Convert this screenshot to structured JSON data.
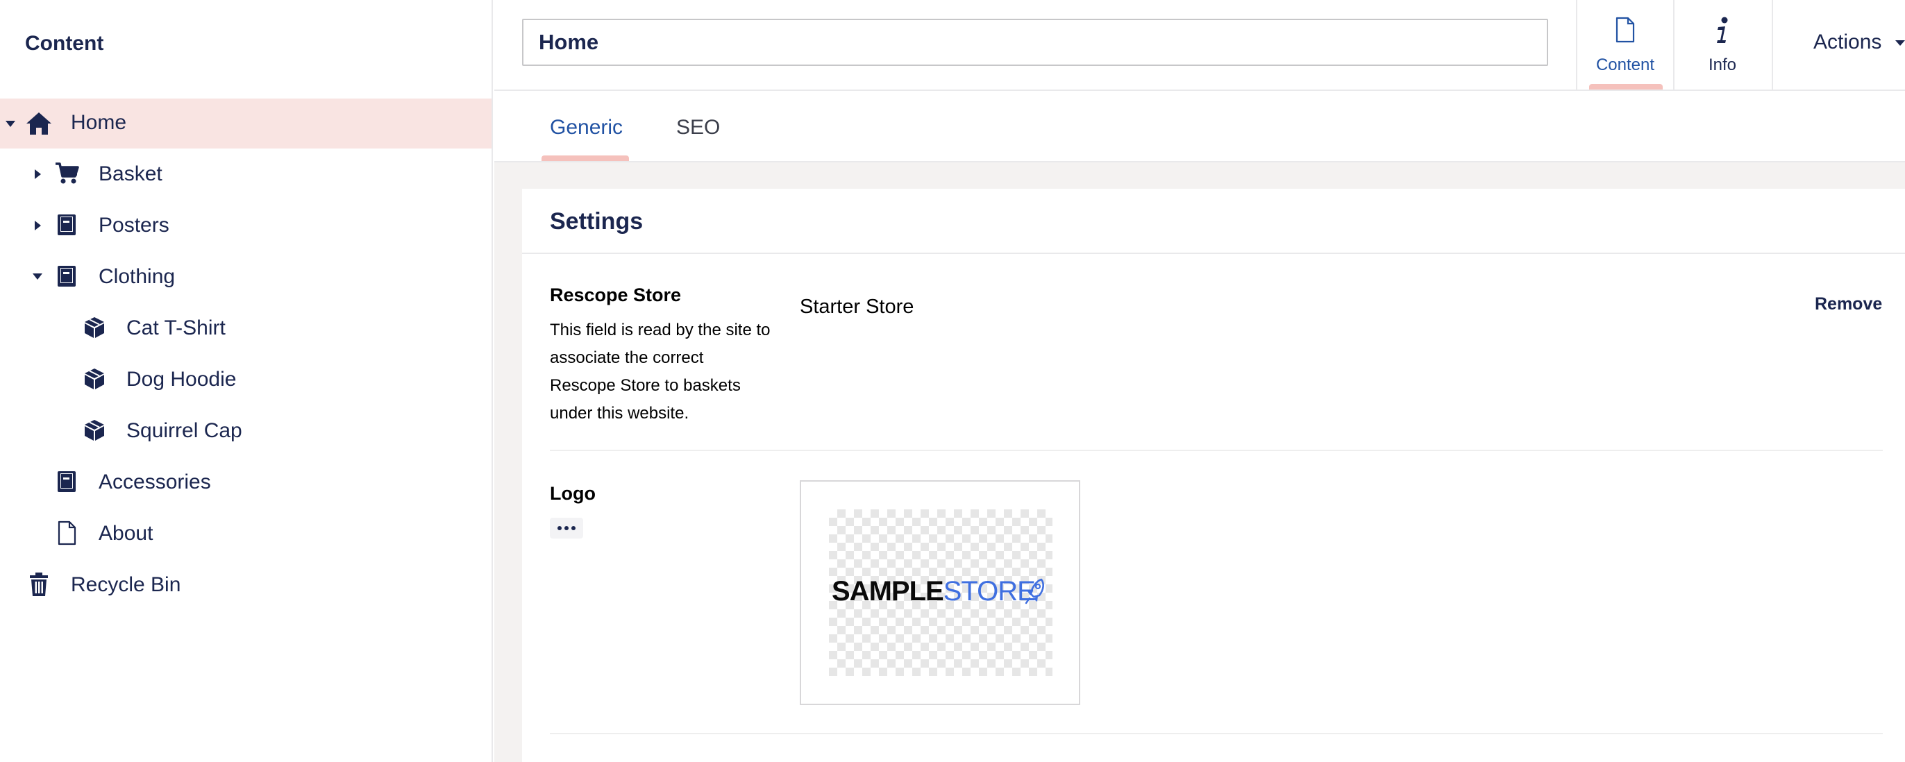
{
  "sidebar": {
    "title": "Content",
    "items": [
      {
        "label": "Home",
        "icon": "home-icon",
        "caret": "down"
      },
      {
        "label": "Basket",
        "icon": "cart-icon",
        "caret": "right"
      },
      {
        "label": "Posters",
        "icon": "book-icon",
        "caret": "right"
      },
      {
        "label": "Clothing",
        "icon": "book-icon",
        "caret": "down"
      },
      {
        "label": "Cat T-Shirt",
        "icon": "box-icon",
        "caret": "none"
      },
      {
        "label": "Dog Hoodie",
        "icon": "box-icon",
        "caret": "none"
      },
      {
        "label": "Squirrel Cap",
        "icon": "box-icon",
        "caret": "none"
      },
      {
        "label": "Accessories",
        "icon": "book-icon",
        "caret": "none"
      },
      {
        "label": "About",
        "icon": "document-icon",
        "caret": "none"
      },
      {
        "label": "Recycle Bin",
        "icon": "trash-icon",
        "caret": "none"
      }
    ]
  },
  "header": {
    "name_value": "Home",
    "apps": [
      {
        "label": "Content",
        "icon": "document-icon",
        "active": true
      },
      {
        "label": "Info",
        "icon": "info-icon",
        "active": false
      }
    ],
    "actions_label": "Actions"
  },
  "tabs": [
    {
      "label": "Generic",
      "active": true
    },
    {
      "label": "SEO",
      "active": false
    }
  ],
  "panel": {
    "title": "Settings",
    "properties": [
      {
        "label": "Rescope Store",
        "description": "This field is read by the site to associate the correct Rescope Store to baskets under this website.",
        "value": "Starter Store",
        "action": "Remove"
      },
      {
        "label": "Logo",
        "logo_text_bold": "SAMPLE",
        "logo_text_light": "STORE"
      }
    ]
  },
  "colors": {
    "accent": "#2152a3",
    "active_highlight": "#f9e4e2",
    "indicator": "#f5c1bc",
    "text_primary": "#1b264f",
    "logo_blue": "#3f6fe0"
  }
}
